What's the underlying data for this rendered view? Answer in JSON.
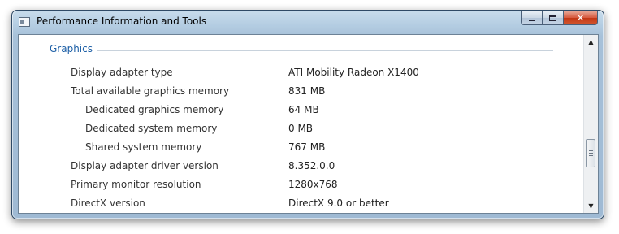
{
  "window": {
    "title": "Performance Information and Tools",
    "close_glyph": "✕"
  },
  "section": {
    "header": "Graphics"
  },
  "rows": [
    {
      "label": "Display adapter type",
      "value": "ATI Mobility Radeon X1400",
      "indent": 0
    },
    {
      "label": "Total available graphics memory",
      "value": "831 MB",
      "indent": 0
    },
    {
      "label": "Dedicated graphics memory",
      "value": "64 MB",
      "indent": 1
    },
    {
      "label": "Dedicated system memory",
      "value": "0 MB",
      "indent": 1
    },
    {
      "label": "Shared system memory",
      "value": "767 MB",
      "indent": 1
    },
    {
      "label": "Display adapter driver version",
      "value": "8.352.0.0",
      "indent": 0
    },
    {
      "label": "Primary monitor resolution",
      "value": "1280x768",
      "indent": 0
    },
    {
      "label": "DirectX version",
      "value": "DirectX 9.0 or better",
      "indent": 0
    }
  ],
  "scrollbar": {
    "up_glyph": "▲",
    "down_glyph": "▼"
  },
  "icons": [
    "app-icon",
    "minimize-icon",
    "maximize-icon",
    "close-icon",
    "scroll-up-icon",
    "scroll-down-icon",
    "scroll-grip-icon"
  ]
}
